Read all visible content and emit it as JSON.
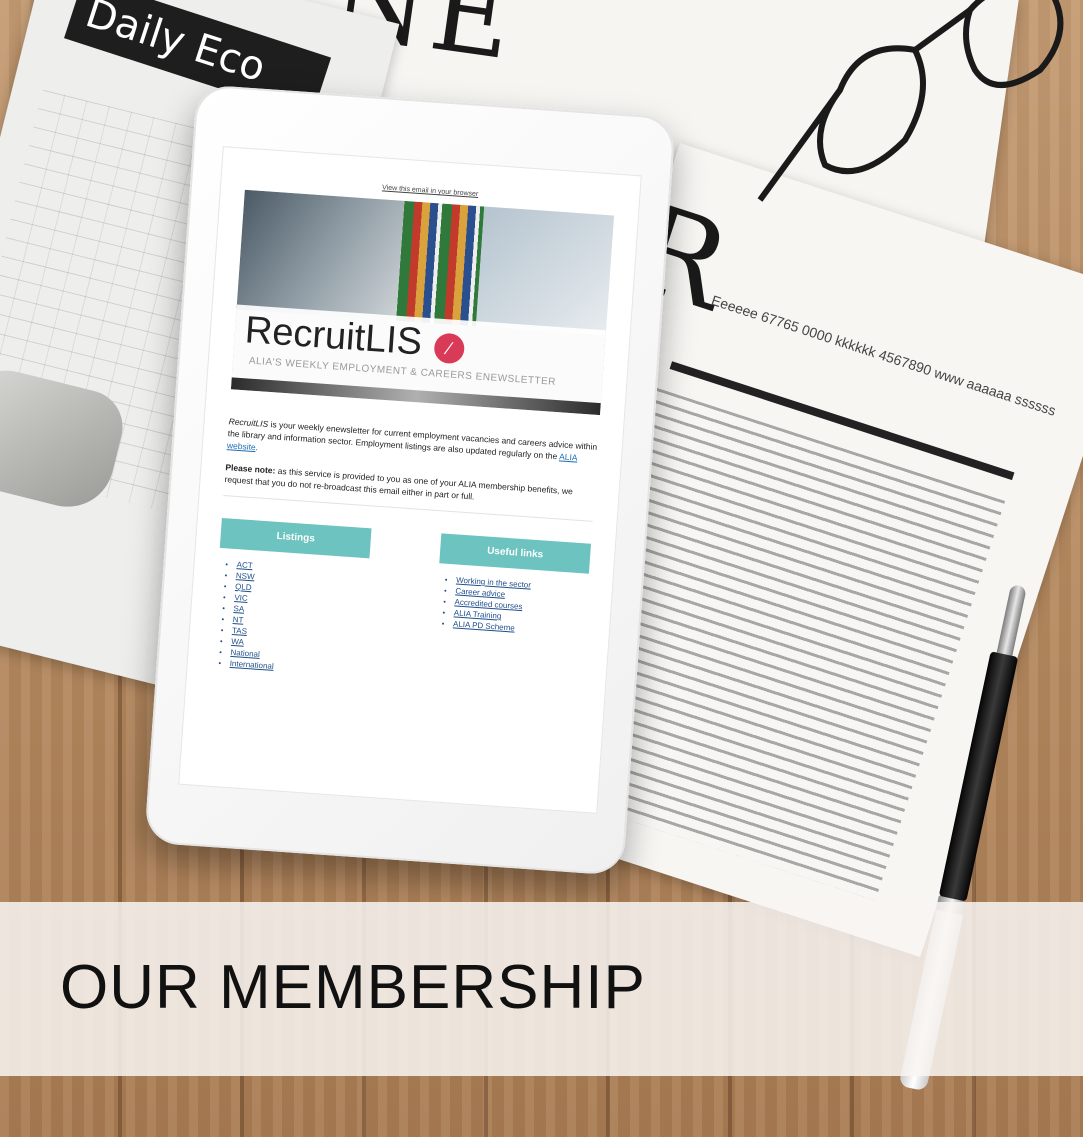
{
  "scene": {
    "caption": "OUR MEMBERSHIP",
    "newspaper_left_masthead": "Daily Eco",
    "newspaper_top_letters": "NE",
    "newspaper_right_letter": "R",
    "newspaper_right_heading": "Eeeeee 67765 0000 kkkkkk 4567890 www aaaaaa ssssss"
  },
  "newsletter": {
    "browser_link": "View this email in your browser",
    "brand_name": "RecruitLIS",
    "brand_logo": "⁄",
    "tagline": "ALIA'S WEEKLY EMPLOYMENT & CAREERS ENEWSLETTER",
    "intro_1_lead": "RecruitLIS",
    "intro_1_body": " is your weekly enewsletter for current employment vacancies and careers advice within the library and information sector. Employment listings are also updated regularly on the ",
    "intro_1_link": "ALIA website",
    "intro_1_end": ".",
    "intro_2_lead": "Please note:",
    "intro_2_body": " as this service is provided to you as one of your ALIA membership benefits, we request that you do not re-broadcast this email either in part or full.",
    "listings": {
      "heading": "Listings",
      "items": [
        "ACT",
        "NSW",
        "QLD",
        "VIC",
        "SA",
        "NT",
        "TAS",
        "WA",
        "National",
        "International"
      ]
    },
    "useful_links": {
      "heading": "Useful links",
      "items": [
        "Working in the sector",
        "Career advice",
        "Accredited courses",
        "ALIA Training",
        "ALIA PD Scheme"
      ]
    }
  },
  "colors": {
    "accent_teal": "#6cc3c0",
    "brand_pink": "#d93a57",
    "wood": "#b68a60"
  }
}
